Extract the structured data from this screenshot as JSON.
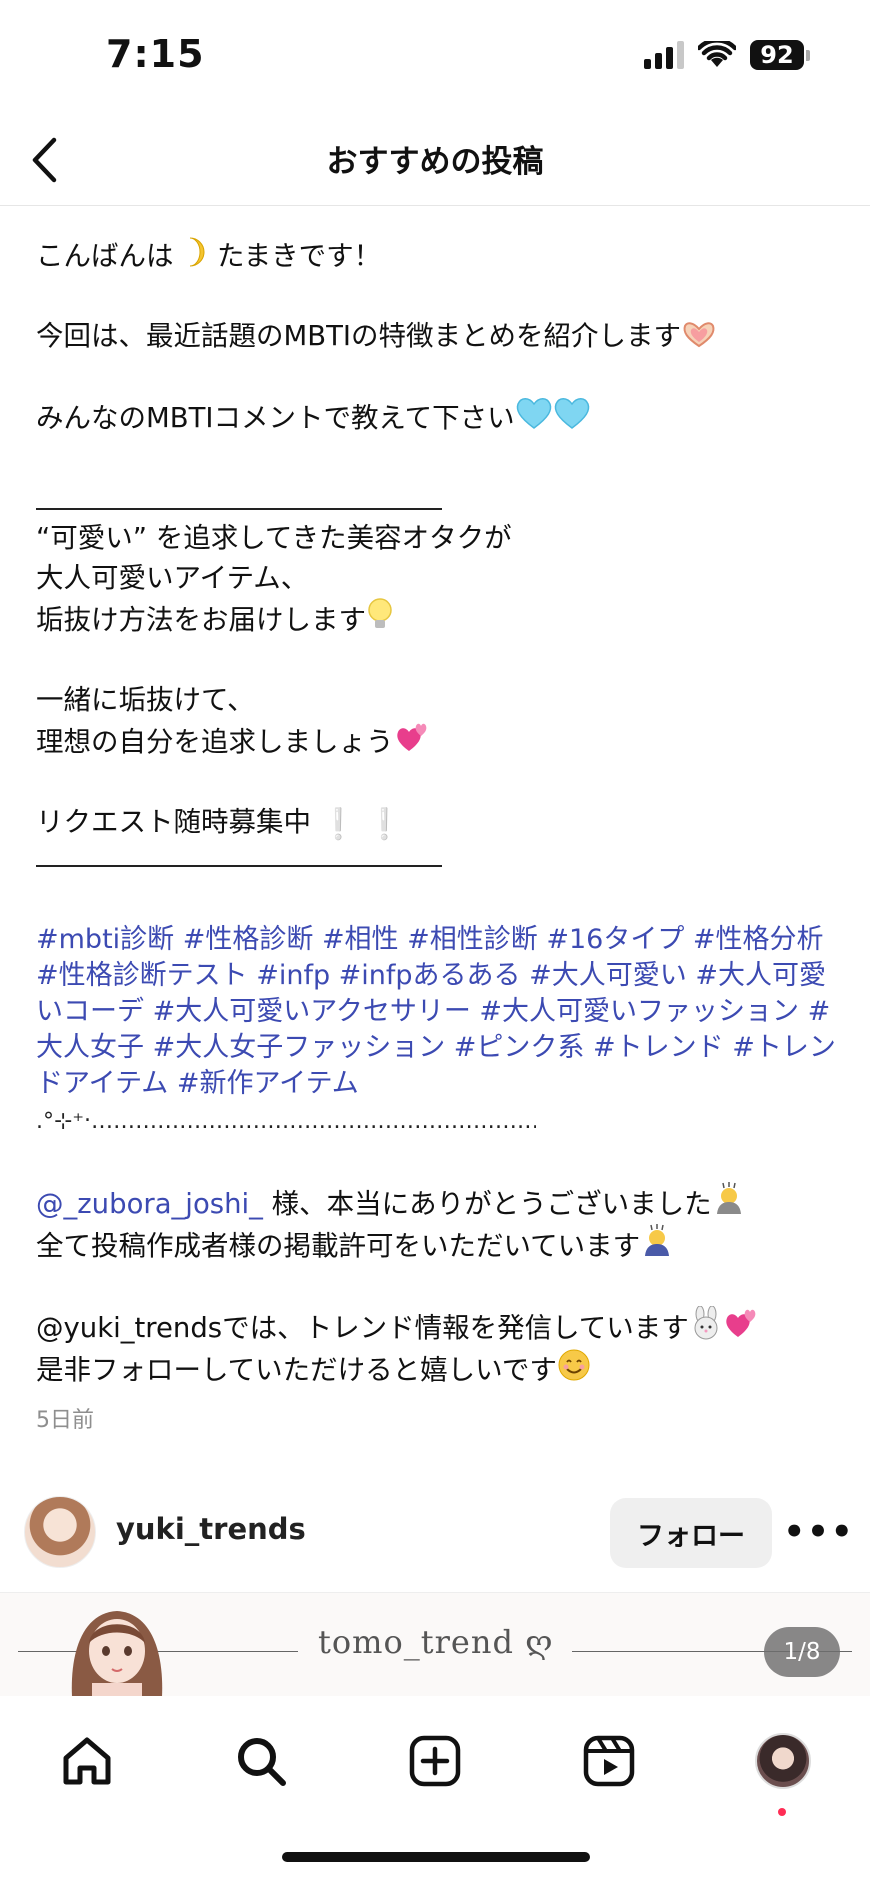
{
  "status_bar": {
    "time": "7:15",
    "battery": "92"
  },
  "header": {
    "title": "おすすめの投稿"
  },
  "caption": {
    "line1": "こんばんは",
    "line1b": "たまきです！",
    "line2": "今回は、最近話題のMBTIの特徴まとめを紹介します",
    "line3": "みんなのMBTIコメントで教えて下さい",
    "line4": "“可愛い” を追求してきた美容オタクが",
    "line5": "大人可愛いアイテム、",
    "line6": "垢抜け方法をお届けします",
    "line7": "一緒に垢抜けて、",
    "line8": "理想の自分を追求しましょう",
    "line9": "リクエスト随時募集中",
    "hashtags": "#mbti診断 #性格診断 #相性 #相性診断 #16タイプ #性格分析 #性格診断テスト #infp #infpあるある #大人可愛い #大人可愛いコーデ #大人可愛いアクセサリー #大人可愛いファッション #大人女子 #大人女子ファッション #ピンク系 #トレンド #トレンドアイテム #新作アイテム",
    "dots": ".°⊹⁺‧‥‥‥‥‥‥‥‥‥‥‥‥‥‥‥‥‥‥‥‥‥‥‥‥‥‥‥‥‥‥‥‥‥⁺ ⊹°.",
    "mention": "@_zubora_joshi_",
    "thanks": " 様、本当にありがとうございました",
    "permission": "全て投稿作成者様の掲載許可をいただいています",
    "promo": "@yuki_trendsでは、トレンド情報を発信しています",
    "follow_ask": "是非フォローしていただけると嬉しいです"
  },
  "timestamp": "5日前",
  "author": {
    "name": "yuki_trends",
    "follow_label": "フォロー",
    "more": "•••"
  },
  "preview": {
    "name": "tomo_trend ღ",
    "page": "1/8"
  },
  "icons": {
    "moon": "crescent-moon-icon",
    "heart_hands": "heart-hands-icon",
    "blue_heart": "light-blue-heart-icon",
    "bulb": "light-bulb-icon",
    "two_hearts": "revolving-hearts-icon",
    "exclaim": "white-exclamation-icon",
    "bow": "bowing-person-icon",
    "rabbit": "rabbit-face-icon",
    "smile": "smiling-face-icon"
  },
  "colors": {
    "hashtag": "#3c4ab2",
    "timestamp": "#8e8e8e",
    "follow_bg": "#efefef",
    "notif_dot": "#ff2d55"
  }
}
